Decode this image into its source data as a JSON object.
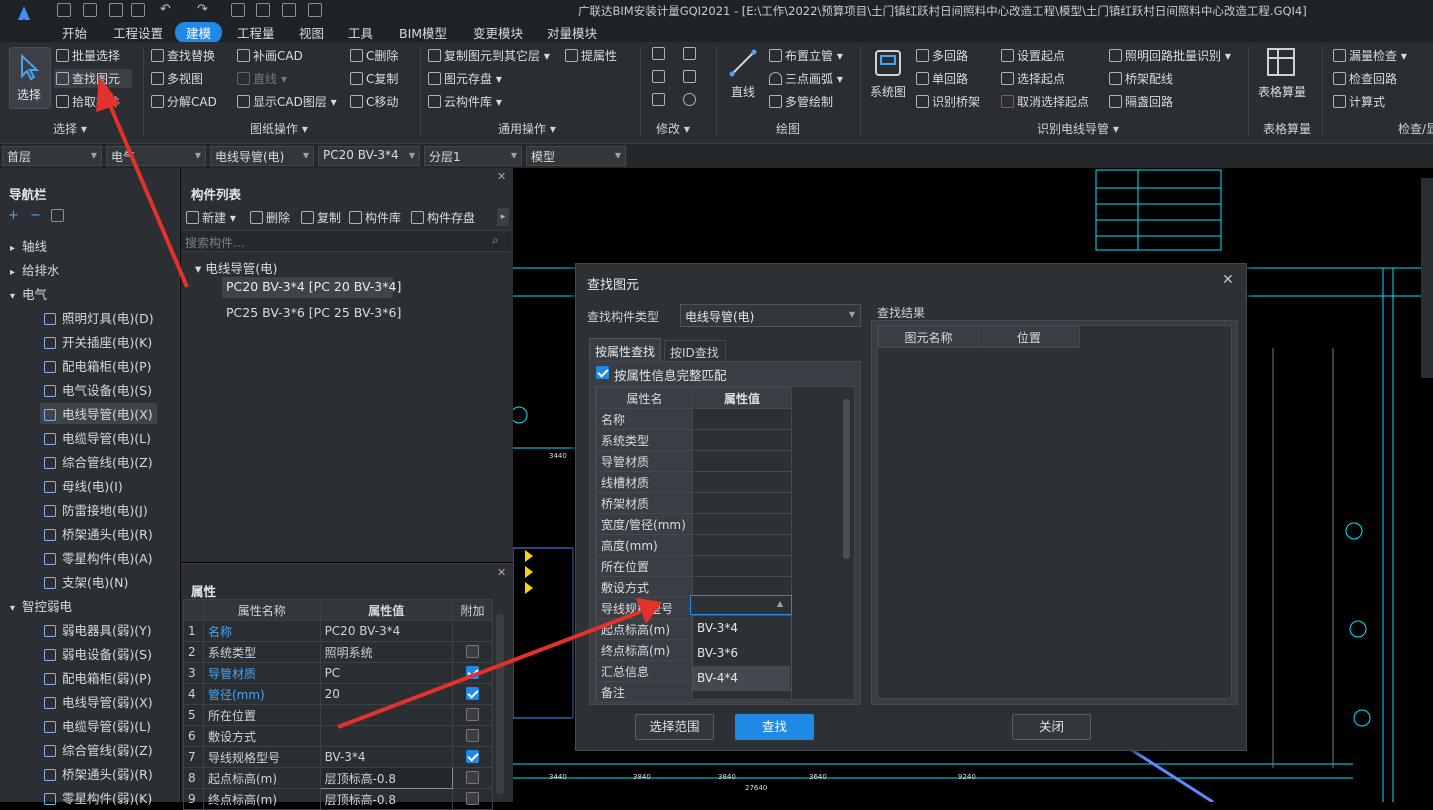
{
  "app": {
    "title": "广联达BIM安装计量GQI2021 - [E:\\工作\\2022\\预算项目\\土门镇红跃村日间照料中心改造工程\\模型\\土门镇红跃村日间照料中心改造工程.GQI4]",
    "menus": [
      "开始",
      "工程设置",
      "建模",
      "工程量",
      "视图",
      "工具",
      "BIM模型",
      "变更模块",
      "对量模块"
    ],
    "active_menu": "建模"
  },
  "ribbon": {
    "select_label": "选择",
    "select_group": {
      "items": [
        "批量选择",
        "查找图元",
        "拾取构件"
      ],
      "group": "选择"
    },
    "drawing_ops": {
      "items": [
        "查找替换",
        "补画CAD",
        "C删除",
        "多视图",
        "直线",
        "C复制",
        "分解CAD",
        "显示CAD图层",
        "C移动"
      ],
      "group": "图纸操作"
    },
    "general_ops": {
      "items": [
        "复制图元到其它层",
        "提属性",
        "图元存盘",
        "云构件库"
      ],
      "group": "通用操作"
    },
    "modify": {
      "group": "修改"
    },
    "draw": {
      "line": "直线",
      "items": [
        "布置立管",
        "三点画弧",
        "多管绘制"
      ],
      "group": "绘图"
    },
    "identify": {
      "system": "系统图",
      "items": [
        "多回路",
        "单回路",
        "识别桥架",
        "设置起点",
        "选择起点",
        "取消选择起点",
        "照明回路批量识别",
        "桥架配线",
        "隔盏回路"
      ],
      "group": "识别电线导管"
    },
    "table_calc": {
      "label": "表格算量",
      "group": "表格算量"
    },
    "check": {
      "items": [
        "漏量检查",
        "检查回路",
        "计算式"
      ],
      "group": "检查/显"
    }
  },
  "combobar": [
    "首层",
    "电气",
    "电线导管(电)",
    "PC20 BV-3*4",
    "分层1",
    "模型"
  ],
  "nav": {
    "title": "导航栏",
    "items": [
      {
        "label": "轴线",
        "level": 0,
        "exp": "▸"
      },
      {
        "label": "给排水",
        "level": 0,
        "exp": "▸"
      },
      {
        "label": "电气",
        "level": 0,
        "exp": "▾"
      },
      {
        "label": "照明灯具(电)(D)",
        "level": 1
      },
      {
        "label": "开关插座(电)(K)",
        "level": 1
      },
      {
        "label": "配电箱柜(电)(P)",
        "level": 1
      },
      {
        "label": "电气设备(电)(S)",
        "level": 1
      },
      {
        "label": "电线导管(电)(X)",
        "level": 1,
        "selected": true
      },
      {
        "label": "电缆导管(电)(L)",
        "level": 1
      },
      {
        "label": "综合管线(电)(Z)",
        "level": 1
      },
      {
        "label": "母线(电)(I)",
        "level": 1
      },
      {
        "label": "防雷接地(电)(J)",
        "level": 1
      },
      {
        "label": "桥架通头(电)(R)",
        "level": 1
      },
      {
        "label": "零星构件(电)(A)",
        "level": 1
      },
      {
        "label": "支架(电)(N)",
        "level": 1
      },
      {
        "label": "智控弱电",
        "level": 0,
        "exp": "▾"
      },
      {
        "label": "弱电器具(弱)(Y)",
        "level": 1
      },
      {
        "label": "弱电设备(弱)(S)",
        "level": 1
      },
      {
        "label": "配电箱柜(弱)(P)",
        "level": 1
      },
      {
        "label": "电线导管(弱)(X)",
        "level": 1
      },
      {
        "label": "电缆导管(弱)(L)",
        "level": 1
      },
      {
        "label": "综合管线(弱)(Z)",
        "level": 1
      },
      {
        "label": "桥架通头(弱)(R)",
        "level": 1
      },
      {
        "label": "零星构件(弱)(K)",
        "level": 1
      }
    ]
  },
  "component_list": {
    "title": "构件列表",
    "toolbar": [
      "新建",
      "删除",
      "复制",
      "构件库",
      "构件存盘"
    ],
    "search_placeholder": "搜索构件...",
    "tree_root": "电线导管(电)",
    "items": [
      "PC20 BV-3*4 [PC 20 BV-3*4]",
      "PC25 BV-3*6 [PC 25 BV-3*6]"
    ]
  },
  "properties": {
    "title": "属性",
    "headers": [
      "属性名称",
      "属性值",
      "附加"
    ],
    "rows": [
      {
        "n": "1",
        "name": "名称",
        "value": "PC20 BV-3*4",
        "blue": true,
        "cb": "none"
      },
      {
        "n": "2",
        "name": "系统类型",
        "value": "照明系统",
        "cb": "off"
      },
      {
        "n": "3",
        "name": "导管材质",
        "value": "PC",
        "blue": true,
        "cb": "on"
      },
      {
        "n": "4",
        "name": "管径(mm)",
        "value": "20",
        "blue": true,
        "cb": "on"
      },
      {
        "n": "5",
        "name": "所在位置",
        "value": "",
        "cb": "off"
      },
      {
        "n": "6",
        "name": "敷设方式",
        "value": "",
        "cb": "off"
      },
      {
        "n": "7",
        "name": "导线规格型号",
        "value": "BV-3*4",
        "cb": "on"
      },
      {
        "n": "8",
        "name": "起点标高(m)",
        "value": "层顶标高-0.8",
        "cb": "off"
      },
      {
        "n": "9",
        "name": "终点标高(m)",
        "value": "层顶标高-0.8",
        "cb": "off"
      }
    ]
  },
  "dialog": {
    "title": "查找图元",
    "type_label": "查找构件类型",
    "type_value": "电线导管(电)",
    "tabs": [
      "按属性查找",
      "按ID查找"
    ],
    "match_label": "按属性信息完整匹配",
    "headers": [
      "属性名",
      "属性值"
    ],
    "props": [
      "名称",
      "系统类型",
      "导管材质",
      "线槽材质",
      "桥架材质",
      "宽度/管径(mm)",
      "高度(mm)",
      "所在位置",
      "敷设方式",
      "导线规格型号",
      "起点标高(m)",
      "终点标高(m)",
      "汇总信息",
      "备注"
    ],
    "dropdown_options": [
      "BV-3*4",
      "BV-3*6",
      "BV-4*4"
    ],
    "result_title": "查找结果",
    "result_headers": [
      "图元名称",
      "位置"
    ],
    "buttons": {
      "range": "选择范围",
      "find": "查找",
      "close": "关闭"
    }
  },
  "colors": {
    "accent": "#1e8ae6",
    "arrow": "#e4322b",
    "cad_line": "#00e5ff",
    "link": "#4aa3f0"
  }
}
